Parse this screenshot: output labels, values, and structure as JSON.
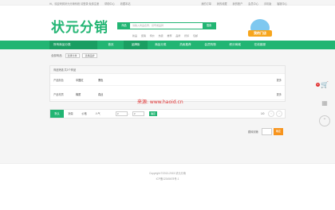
{
  "topbar": {
    "links_left": [
      "Hi，欢迎来到状元分销系统 请登录 免费注册",
      "帮助中心",
      "收藏本站"
    ],
    "links_right": [
      "我的订单",
      "我的收藏",
      "我的账户",
      "会员中心",
      "手机版",
      "客服中心"
    ]
  },
  "brand": {
    "logo": "状元分销",
    "badge": "我的门店"
  },
  "search": {
    "category": "商品",
    "placeholder": "请输入商品名称、货号或品牌",
    "button": "搜索",
    "hotwords": [
      "新品",
      "促销",
      "特价",
      "热卖",
      "推荐",
      "品牌",
      "折扣",
      "包邮"
    ]
  },
  "nav": {
    "all_categories": "所有商品分类",
    "items": [
      "首页",
      "品牌街",
      "商品分类",
      "热卖推荐",
      "会员购物",
      "积分商城",
      "在线客服"
    ],
    "active_index": 1
  },
  "breadcrumb": {
    "label": "全部商品",
    "dropdown1": "选择分类",
    "dropdown2": "选择品牌"
  },
  "filter": {
    "summary": "商品筛选 共0个商品",
    "rows": [
      {
        "key": "产品颜色",
        "values": [
          "中国红",
          "黑色"
        ],
        "more": "更多"
      },
      {
        "key": "产品材质",
        "values": [
          "棉质",
          "真丝"
        ],
        "more": "更多"
      }
    ]
  },
  "watermark": "来源: www.haoid.cn",
  "sort": {
    "tabs": [
      "默认",
      "销量",
      "价格",
      "人气"
    ],
    "active_index": 0,
    "price_from": "¥",
    "price_to": "¥",
    "dash": "-",
    "go": "确定",
    "page": "1/0",
    "prev": "‹",
    "next": "›"
  },
  "pager": {
    "label": "跳转到第",
    "ok": "确定"
  },
  "footer": {
    "copyright": "Copyright ©2013-2015 状元分销",
    "icp": "ICP备12345678号-1"
  },
  "sidebar": {
    "cart_count": "0",
    "cart_icon": "cart-icon",
    "qr_icon": "qr-icon",
    "top_icon": "back-to-top-icon"
  },
  "colors": {
    "brand": "#22b573",
    "brand_dark": "#1a9e62",
    "accent": "#f7941d",
    "watermark": "#e03030"
  }
}
